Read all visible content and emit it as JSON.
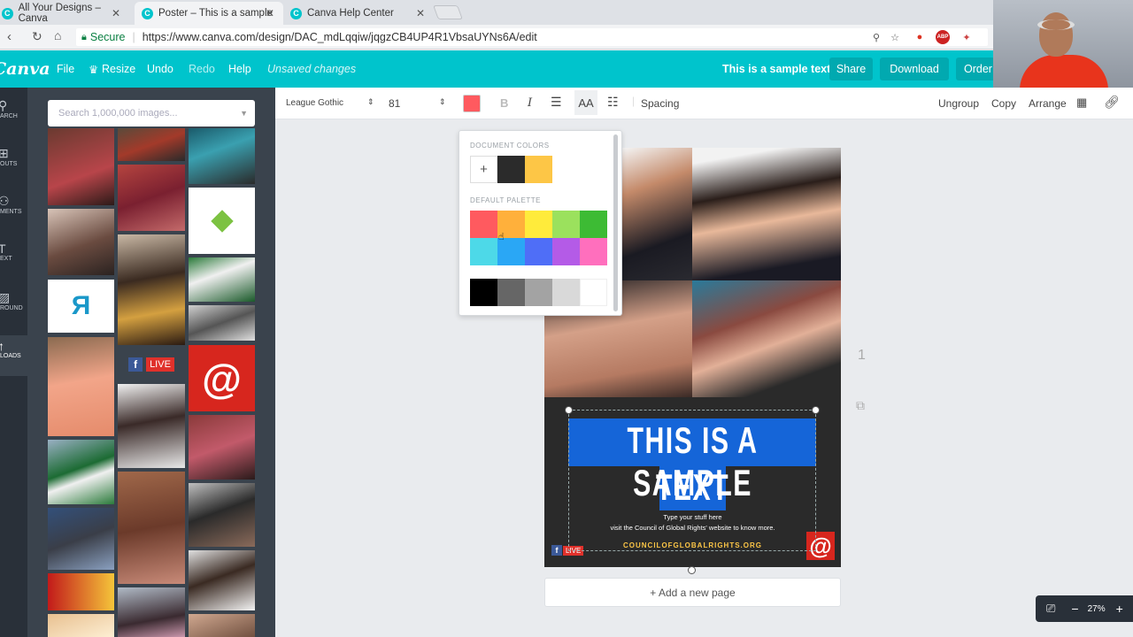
{
  "browser": {
    "tabs": [
      {
        "label": "All Your Designs – Canva"
      },
      {
        "label": "Poster – This is a sample"
      },
      {
        "label": "Canva Help Center"
      }
    ],
    "secure_label": "Secure",
    "url": "https://www.canva.com/design/DAC_mdLqqiw/jqgzCB4UP4R1VbsaUYNs6A/edit"
  },
  "header": {
    "logo": "Canva",
    "menu": [
      "File",
      "Resize",
      "Undo",
      "Redo",
      "Help"
    ],
    "unsaved": "Unsaved changes",
    "design_title": "This is a sample text",
    "share_label": "Share",
    "download_label": "Download",
    "order_label": "Order"
  },
  "sidebar": {
    "items": [
      {
        "label": "ARCH",
        "icon": "search-icon"
      },
      {
        "label": "OUTS",
        "icon": "layouts-icon"
      },
      {
        "label": "MENTS",
        "icon": "elements-icon"
      },
      {
        "label": "EXT",
        "icon": "text-icon"
      },
      {
        "label": "ROUND",
        "icon": "background-icon"
      },
      {
        "label": "LOADS",
        "icon": "upload-icon"
      }
    ]
  },
  "uploads": {
    "search_placeholder": "Search 1,000,000 images...",
    "fb_live_text": "LIVE"
  },
  "toolbar": {
    "font": "League Gothic",
    "size": "81",
    "bold": "B",
    "italic": "I",
    "case": "AA",
    "spacing": "Spacing",
    "ungroup": "Ungroup",
    "copy": "Copy",
    "arrange": "Arrange",
    "text_color": "#ff5a5f"
  },
  "color_picker": {
    "document_colors_label": "DOCUMENT COLORS",
    "add_symbol": "+",
    "document_colors": [
      "#2b2b2b",
      "#fdc646"
    ],
    "default_palette_label": "DEFAULT PALETTE",
    "palette_row1": [
      "#ff5a5f",
      "#ffb03b",
      "#ffeb3b",
      "#9be15d",
      "#3dbb34"
    ],
    "palette_row2": [
      "#4dd9e8",
      "#2aa7f5",
      "#4f6ef7",
      "#b45be7",
      "#ff6fbd"
    ],
    "grays": [
      "#000000",
      "#666666",
      "#a3a3a3",
      "#d9d9d9",
      "#ffffff"
    ]
  },
  "poster": {
    "headline_line1": "THIS IS A SAMPLE",
    "headline_line2": "TEXT",
    "sub1": "Type your stuff here",
    "sub2": "visit the Council of Global Rights' website to know more.",
    "website": "COUNCILOFGLOBALRIGHTS.ORG",
    "fb_badge": "LIVE"
  },
  "page_number": "1",
  "add_page_label": "+ Add a new page",
  "zoom_level": "27%"
}
